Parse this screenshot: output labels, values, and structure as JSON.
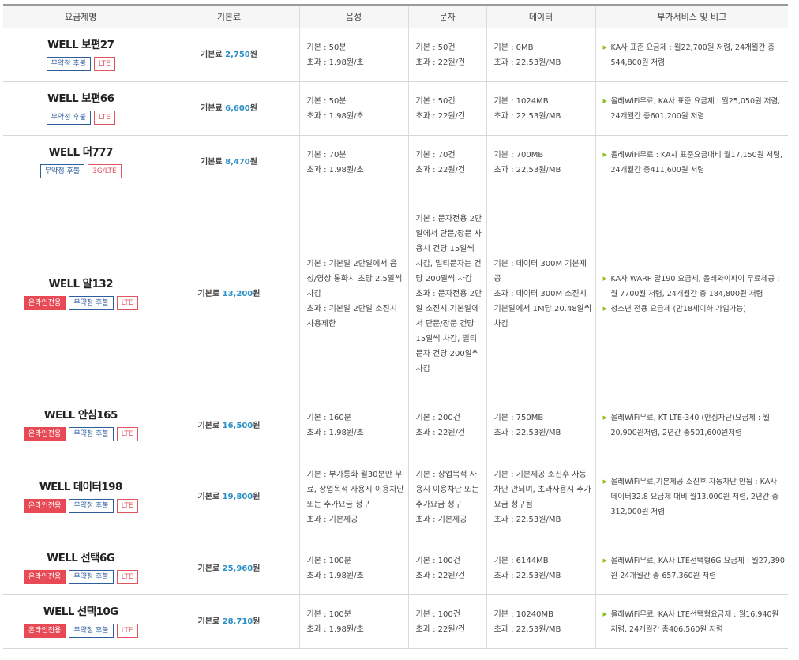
{
  "headers": {
    "plan": "요금제명",
    "fee": "기본료",
    "voice": "음성",
    "sms": "문자",
    "data": "데이터",
    "extra": "부가서비스 및 비고"
  },
  "fee_label": "기본료",
  "won": "원",
  "plans": [
    {
      "name": "WELL 보편27",
      "badges": [
        "무약정 후불",
        "LTE"
      ],
      "fee": "2,750",
      "voice": [
        "기본 : 50분",
        "초과 : 1.98원/초"
      ],
      "sms": [
        "기본 : 50건",
        "초과 : 22원/건"
      ],
      "data": [
        "기본 : 0MB",
        "초과 : 22.53원/MB"
      ],
      "extra": [
        "KA사 표준 요금제 : 월22,700원 저렴, 24개월간 총544,800원 저렴"
      ]
    },
    {
      "name": "WELL 보편66",
      "badges": [
        "무약정 후불",
        "LTE"
      ],
      "fee": "6,600",
      "voice": [
        "기본 : 50분",
        "초과 : 1.98원/초"
      ],
      "sms": [
        "기본 : 50건",
        "초과 : 22원/건"
      ],
      "data": [
        "기본 : 1024MB",
        "초과 : 22.53원/MB"
      ],
      "extra": [
        "올레WiFi무료, KA사 표준 요금제 : 월25,050원 저렴, 24개월간 총601,200원 저렴"
      ]
    },
    {
      "name": "WELL 더777",
      "badges": [
        "무약정 후불",
        "3G/LTE"
      ],
      "fee": "8,470",
      "voice": [
        "기본 : 70분",
        "초과 : 1.98원/초"
      ],
      "sms": [
        "기본 : 70건",
        "초과 : 22원/건"
      ],
      "data": [
        "기본 : 700MB",
        "초과 : 22.53원/MB"
      ],
      "extra": [
        "올레WiFi무료 : KA사 표준요금대비 월17,150원 저렴, 24개월간 총411,600원 저렴"
      ]
    },
    {
      "name": "WELL 알132",
      "badges": [
        "온라인전용",
        "무약정 후불",
        "LTE"
      ],
      "fee": "13,200",
      "voice": [
        "기본 : 기본알 2만알에서 음성/영상 통화시 초당 2.5알씩 차감",
        "초과 : 기본알 2만알 소진시 사용제한"
      ],
      "sms": [
        "기본 : 문자전용 2만알에서 단문/장문 사용시 건당 15알씩 차감, 멀티문자는 건당 200알씩 차감",
        "초과 : 문자전용 2만알 소진시 기본알에서 단문/장문 건당 15알씩 차감, 멀티문자 건당 200알씩 차감"
      ],
      "data": [
        "기본 : 데이터 300M 기본제공",
        "초과 : 데이터 300M 소진시 기본알에서 1M당 20.48알씩 차감"
      ],
      "extra": [
        "KA사 WARP 알190 요금제, 올레와이파이 무료제공 : 월 7700월 저렴, 24개월간 총 184,800원 저렴",
        "청소년 전용 요금제 (만18세이하 가입가능)"
      ]
    },
    {
      "name": "WELL 안심165",
      "badges": [
        "온라인전용",
        "무약정 후불",
        "LTE"
      ],
      "fee": "16,500",
      "voice": [
        "기본 : 160분",
        "초과 : 1.98원/초"
      ],
      "sms": [
        "기본 : 200건",
        "초과 : 22원/건"
      ],
      "data": [
        "기본 : 750MB",
        "초과 : 22.53원/MB"
      ],
      "extra": [
        "올레WiFi무료, KT LTE-340 (안심차단)요금제 : 월20,900원저렴, 2년간 총501,600원저렴"
      ]
    },
    {
      "name": "WELL 데이터198",
      "badges": [
        "온라인전용",
        "무약정 후불",
        "LTE"
      ],
      "fee": "19,800",
      "voice": [
        "기본 : 부가통화 월30분만 무료, 상업목적 사용시 이용차단 또는 추가요금 청구",
        "초과 : 기본제공"
      ],
      "sms": [
        "기본 : 상업목적 사용시 이용차단 또는 추가요금 청구",
        "초과 : 기본제공"
      ],
      "data": [
        "기본 : 기본제공 소진후 자동차단 안되며, 초과사용시 추가요금 청구됨",
        "초과 : 22.53원/MB"
      ],
      "extra": [
        "올레WiFi무료,기본제공 소진후 자동차단 안됨 : KA사 데이터32.8 요금제 대비 월13,000원 저렴, 2년간 총312,000원 저렴"
      ]
    },
    {
      "name": "WELL 선택6G",
      "badges": [
        "온라인전용",
        "무약정 후불",
        "LTE"
      ],
      "fee": "25,960",
      "voice": [
        "기본 : 100분",
        "초과 : 1.98원/초"
      ],
      "sms": [
        "기본 : 100건",
        "초과 : 22원/건"
      ],
      "data": [
        "기본 : 6144MB",
        "초과 : 22.53원/MB"
      ],
      "extra": [
        "올레WiFi무료, KA사 LTE선택형6G 요금제 : 월27,390원 24개월간 총 657,360원 저렴"
      ]
    },
    {
      "name": "WELL 선택10G",
      "badges": [
        "온라인전용",
        "무약정 후불",
        "LTE"
      ],
      "fee": "28,710",
      "voice": [
        "기본 : 100분",
        "초과 : 1.98원/초"
      ],
      "sms": [
        "기본 : 100건",
        "초과 : 22원/건"
      ],
      "data": [
        "기본 : 10240MB",
        "초과 : 22.53원/MB"
      ],
      "extra": [
        "올레WiFi무료, KA사 LTE선택형요금제 : 월16,940원 저렴, 24개월간 총406,560원 저렴"
      ]
    }
  ],
  "colors": {
    "fee_amount": "#2a8fc4",
    "badge_blue": "#2f5e9e",
    "badge_red": "#e0555e",
    "online_fill": "#e84a55",
    "bullet_arrow": "#8fbf20"
  },
  "icons": {
    "bullet": "arrow-bullet-icon"
  }
}
